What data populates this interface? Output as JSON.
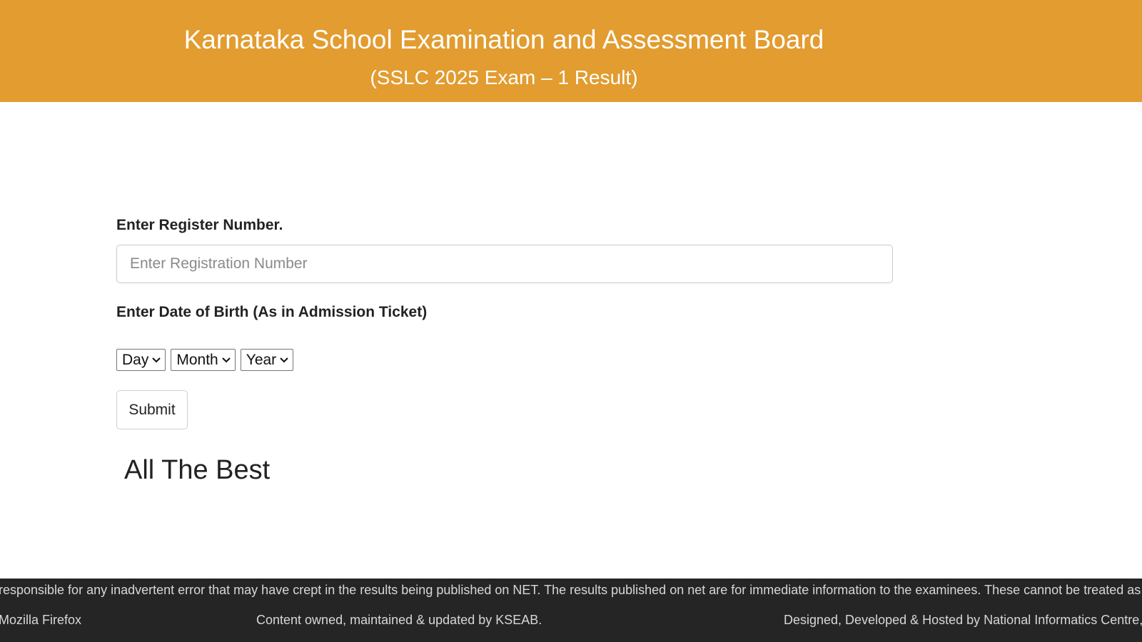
{
  "header": {
    "title": "Karnataka School Examination and Assessment Board",
    "subtitle": "(SSLC 2025 Exam – 1 Result)",
    "background_color": "#e29c2f"
  },
  "form": {
    "register_label": "Enter Register Number.",
    "register_placeholder": "Enter Registration Number",
    "register_value": "",
    "dob_label": "Enter Date of Birth (As in Admission Ticket)",
    "day_select": "Day",
    "month_select": "Month",
    "year_select": "Year",
    "submit_label": "Submit"
  },
  "message": "All The Best",
  "footer": {
    "marquee_text": "responsible for any inadvertent error that may have crept in the results being published on NET. The results published on net are for immediate information to the examinees. These cannot be treated as original mark",
    "browser_note": "Mozilla Firefox",
    "content_note": "Content owned, maintained & updated by KSEAB.",
    "design_note": "Designed, Developed & Hosted by National Informatics Centre, Kar",
    "background_color": "#252525"
  }
}
